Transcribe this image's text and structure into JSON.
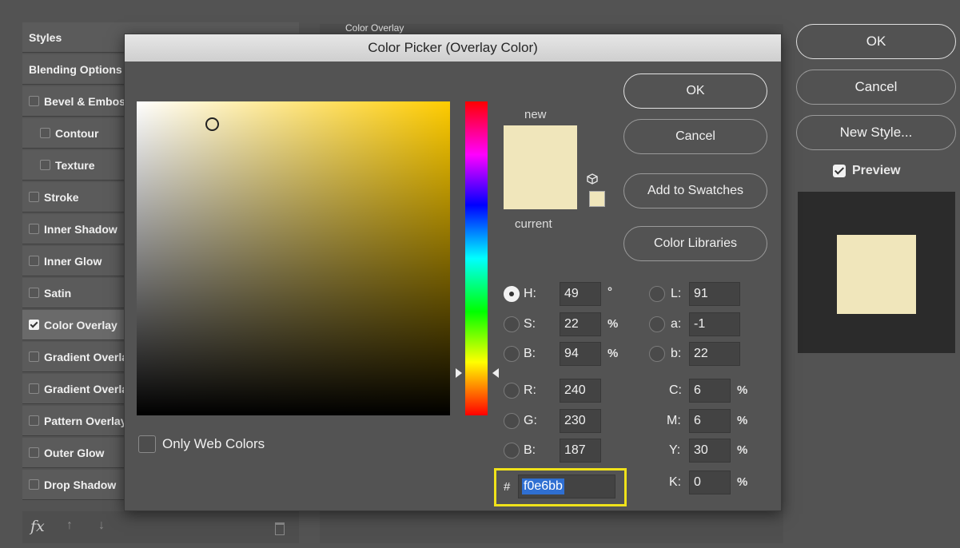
{
  "sidebar": {
    "items": [
      {
        "label": "Styles",
        "checkbox": false,
        "checked": false,
        "indent": 0
      },
      {
        "label": "Blending Options",
        "checkbox": false,
        "checked": false,
        "indent": 0
      },
      {
        "label": "Bevel & Emboss",
        "checkbox": true,
        "checked": false,
        "indent": 0
      },
      {
        "label": "Contour",
        "checkbox": true,
        "checked": false,
        "indent": 1
      },
      {
        "label": "Texture",
        "checkbox": true,
        "checked": false,
        "indent": 1
      },
      {
        "label": "Stroke",
        "checkbox": true,
        "checked": false,
        "indent": 0
      },
      {
        "label": "Inner Shadow",
        "checkbox": true,
        "checked": false,
        "indent": 0
      },
      {
        "label": "Inner Glow",
        "checkbox": true,
        "checked": false,
        "indent": 0
      },
      {
        "label": "Satin",
        "checkbox": true,
        "checked": false,
        "indent": 0
      },
      {
        "label": "Color Overlay",
        "checkbox": true,
        "checked": true,
        "indent": 0,
        "selected": true
      },
      {
        "label": "Gradient Overlay",
        "checkbox": true,
        "checked": false,
        "indent": 0
      },
      {
        "label": "Gradient Overlay",
        "checkbox": true,
        "checked": false,
        "indent": 0
      },
      {
        "label": "Pattern Overlay",
        "checkbox": true,
        "checked": false,
        "indent": 0
      },
      {
        "label": "Outer Glow",
        "checkbox": true,
        "checked": false,
        "indent": 0
      },
      {
        "label": "Drop Shadow",
        "checkbox": true,
        "checked": false,
        "indent": 0
      }
    ],
    "footer": {
      "fx": "fx"
    }
  },
  "background_panel": {
    "title": "Color Overlay"
  },
  "right_column": {
    "ok_label": "OK",
    "cancel_label": "Cancel",
    "new_style_label": "New Style...",
    "preview_label": "Preview",
    "preview_checked": true
  },
  "dialog": {
    "title": "Color Picker (Overlay Color)",
    "new_label": "new",
    "current_label": "current",
    "ok_label": "OK",
    "cancel_label": "Cancel",
    "add_swatches_label": "Add to Swatches",
    "color_libraries_label": "Color Libraries",
    "only_web_colors_label": "Only Web Colors",
    "only_web_colors_checked": false,
    "hsb": {
      "h": {
        "label": "H:",
        "value": "49",
        "unit": "°",
        "selected": true
      },
      "s": {
        "label": "S:",
        "value": "22",
        "unit": "%",
        "selected": false
      },
      "b": {
        "label": "B:",
        "value": "94",
        "unit": "%",
        "selected": false
      }
    },
    "rgb": {
      "r": {
        "label": "R:",
        "value": "240"
      },
      "g": {
        "label": "G:",
        "value": "230"
      },
      "b": {
        "label": "B:",
        "value": "187"
      }
    },
    "lab": {
      "l": {
        "label": "L:",
        "value": "91"
      },
      "a": {
        "label": "a:",
        "value": "-1"
      },
      "b": {
        "label": "b:",
        "value": "22"
      }
    },
    "cmyk": {
      "c": {
        "label": "C:",
        "value": "6",
        "unit": "%"
      },
      "m": {
        "label": "M:",
        "value": "6",
        "unit": "%"
      },
      "y": {
        "label": "Y:",
        "value": "30",
        "unit": "%"
      },
      "k": {
        "label": "K:",
        "value": "0",
        "unit": "%"
      }
    },
    "hex": {
      "hash": "#",
      "value": "f0e6bb"
    }
  },
  "colors": {
    "selected_color": "#f0e6bb",
    "hex_highlight": "#f0e21a",
    "hex_selection": "#2f6fd2"
  }
}
